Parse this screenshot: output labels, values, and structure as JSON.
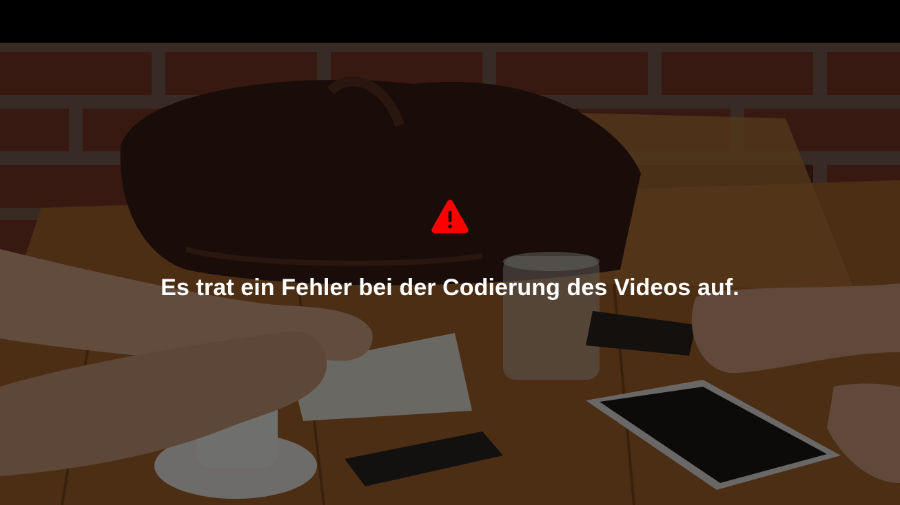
{
  "error": {
    "icon": "warning-triangle-icon",
    "icon_color": "#ff0000",
    "message": "Es trat ein Fehler bei der Codierung des Videos auf."
  },
  "background": {
    "description_icon": "video-poster-image"
  }
}
